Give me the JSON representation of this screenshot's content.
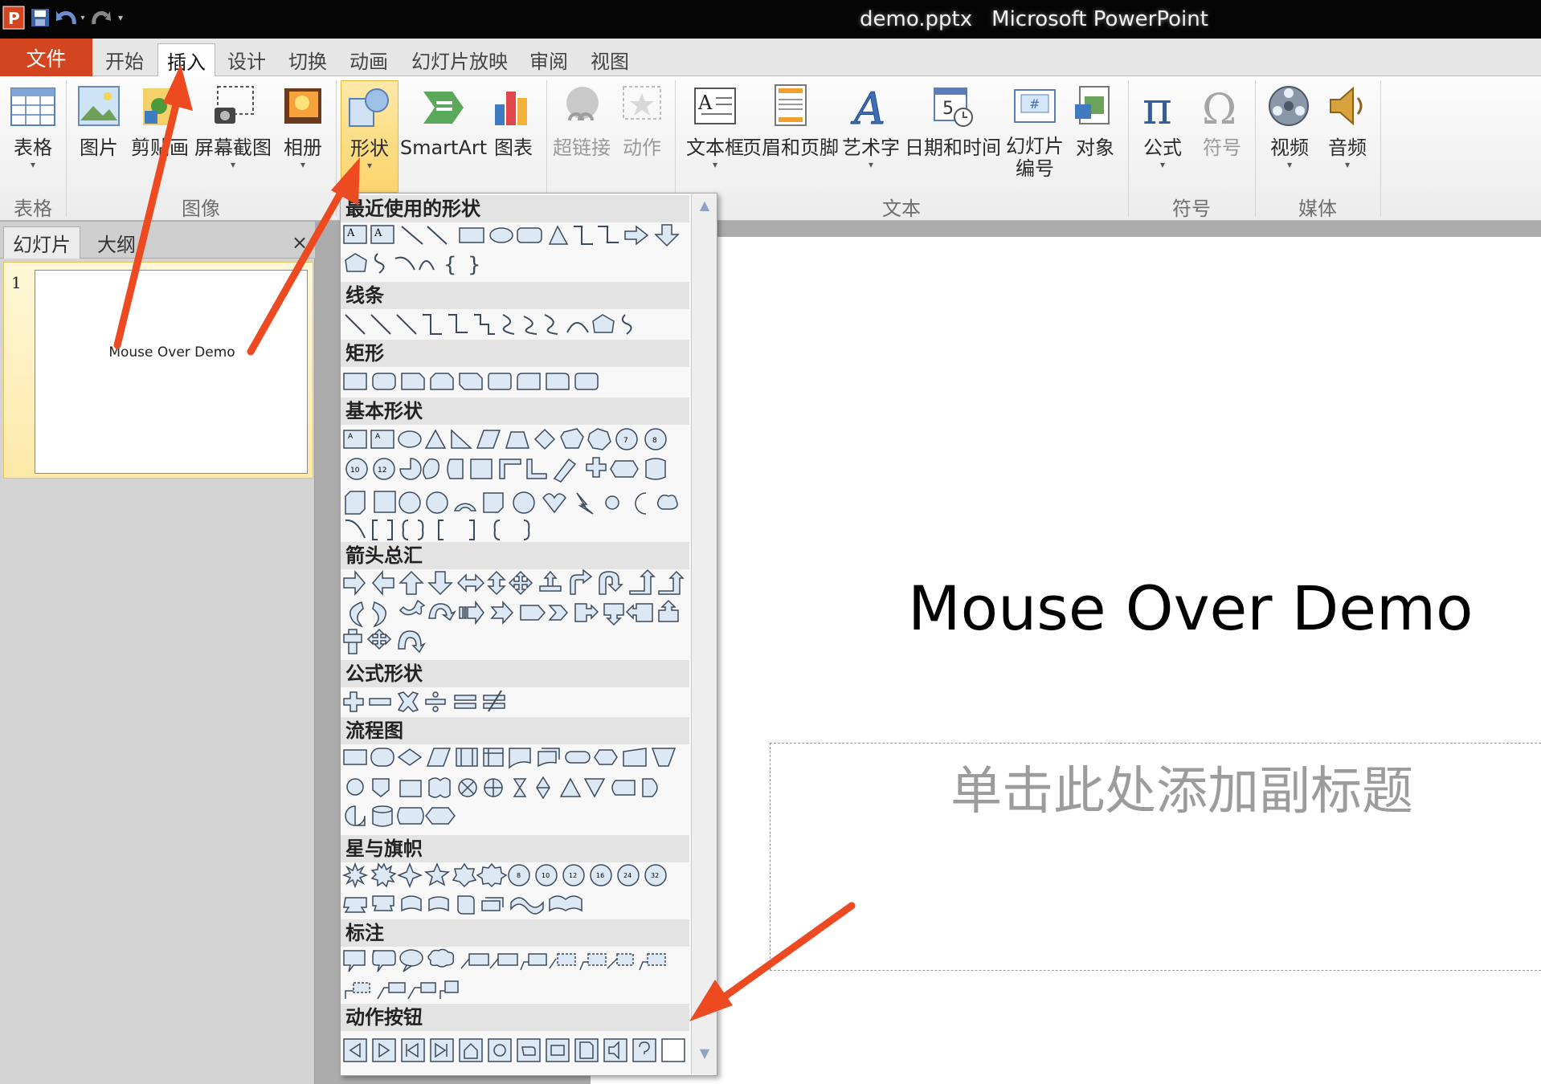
{
  "titlebar": {
    "file_name": "demo.pptx",
    "app_name": "Microsoft PowerPoint"
  },
  "tabs": [
    "文件",
    "开始",
    "插入",
    "设计",
    "切换",
    "动画",
    "幻灯片放映",
    "审阅",
    "视图"
  ],
  "ribbon": {
    "buttons": {
      "table": "表格",
      "picture": "图片",
      "clipart": "剪贴画",
      "screenshot": "屏幕截图",
      "album": "相册",
      "shapes": "形状",
      "smartart": "SmartArt",
      "chart": "图表",
      "hyperlink": "超链接",
      "action": "动作",
      "textbox": "文本框",
      "header_footer": "页眉和页脚",
      "wordart": "艺术字",
      "datetime": "日期和时间",
      "slide_number_1": "幻灯片",
      "slide_number_2": "编号",
      "object": "对象",
      "equation": "公式",
      "symbol": "符号",
      "video": "视频",
      "audio": "音频"
    },
    "groups": {
      "tables": "表格",
      "images": "图像",
      "text": "文本",
      "symbols": "符号",
      "media": "媒体"
    }
  },
  "slide_pane": {
    "tab_slides": "幻灯片",
    "tab_outline": "大纲",
    "close": "×",
    "slide_number": "1",
    "thumb_title": "Mouse Over Demo"
  },
  "slide": {
    "title": "Mouse Over Demo",
    "subtitle_placeholder": "单击此处添加副标题"
  },
  "gallery": {
    "sections": {
      "recent": "最近使用的形状",
      "lines": "线条",
      "rectangles": "矩形",
      "basic": "基本形状",
      "arrows": "箭头总汇",
      "equation": "公式形状",
      "flowchart": "流程图",
      "stars": "星与旗帜",
      "callouts": "标注",
      "action_buttons": "动作按钮"
    },
    "scroll_up": "▲",
    "scroll_down": "▼"
  },
  "colors": {
    "file_tab": "#d2451f",
    "annotation_arrow": "#ee4a22",
    "shape_fill": "#dce8f4",
    "shape_stroke": "#3c4a5e"
  }
}
